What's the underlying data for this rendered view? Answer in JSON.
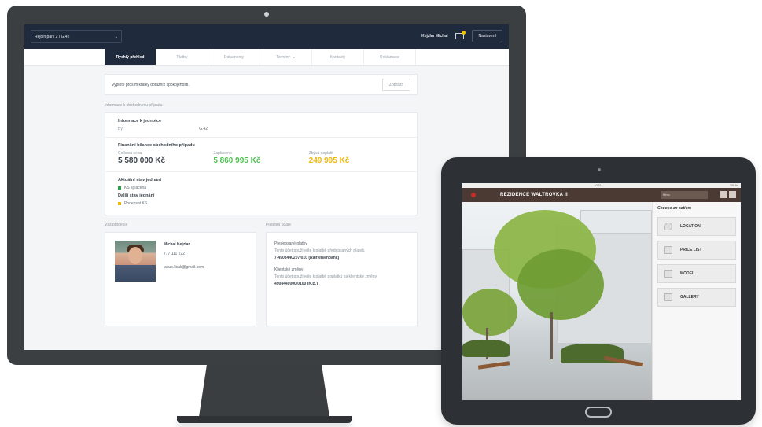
{
  "desktop": {
    "project_select": "Rejčín park 2 / G.42",
    "user_name": "Kejzlar Michal",
    "settings_label": "Nastavení",
    "tabs": [
      {
        "label": "Rychlý přehled"
      },
      {
        "label": "Platby"
      },
      {
        "label": "Dokumenty"
      },
      {
        "label": "Termíny"
      },
      {
        "label": "Kontakty"
      },
      {
        "label": "Reklamace"
      }
    ],
    "survey": {
      "text": "Vyplňte prosím krátký dotazník spokojenosti.",
      "button": "Zobrazit"
    },
    "section_title": "Informace k obchodnímu případu",
    "unit": {
      "title": "Informace k jednotce",
      "key": "Byt",
      "value": "G.42"
    },
    "finance": {
      "title": "Finanční bilance obchodního případu",
      "cols": [
        {
          "label": "Celková cena",
          "value": "5 580 000 Kč",
          "color": "#3c444c"
        },
        {
          "label": "Zaplaceno",
          "value": "5 860 995 Kč",
          "color": "#4cc04f"
        },
        {
          "label": "Zbývá doplatit",
          "value": "249 995 Kč",
          "color": "#f2b705"
        }
      ]
    },
    "status_current": {
      "title": "Aktuální stav jednání",
      "item": "KS splacena",
      "color": "#27a24a"
    },
    "status_next": {
      "title": "Další stav jednání",
      "item": "Podepsat KS",
      "color": "#f2b705"
    },
    "seller": {
      "title": "Váš prodejce",
      "name": "Michal Kejzlar",
      "phone": "777 111 222",
      "email": "jakub.licak@gmail.com"
    },
    "payment": {
      "title": "Platební údaje",
      "planned_title": "Předepsané platby",
      "planned_text": "Tento účet používejte k platbě předepsaných plateb.",
      "planned_account": "7-4908440207/010 (Raiffeisenbank)",
      "client_title": "Klientské změny",
      "client_text": "Tento účet používejte k platbě poplatků za klientské změny.",
      "client_account": "4908440000/0100 (K.B.)"
    }
  },
  "tablet": {
    "status_time": "10:21",
    "status_battery": "100 %",
    "title": "REZIDENCE WALTROVKA II",
    "menu_label": "Menu",
    "choose_label": "Choose an action:",
    "actions": [
      {
        "label": "LOCATION",
        "icon": "location-pin-icon"
      },
      {
        "label": "PRICE LIST",
        "icon": "chart-icon"
      },
      {
        "label": "MODEL",
        "icon": "building-icon"
      },
      {
        "label": "GALLERY",
        "icon": "image-icon"
      }
    ]
  }
}
